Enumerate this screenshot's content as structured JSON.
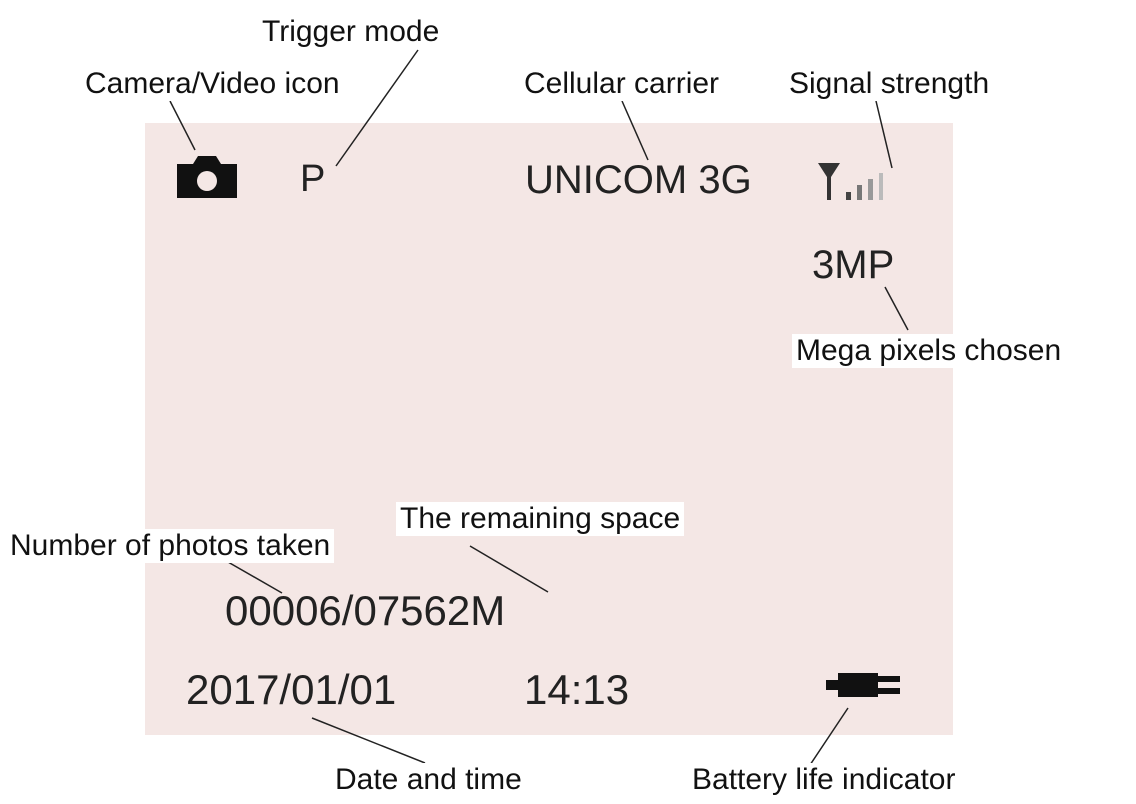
{
  "lcd": {
    "trigger_mode": "P",
    "carrier": "UNICOM 3G",
    "megapixels": "3MP",
    "photo_count_and_space": "00006/07562M",
    "date": "2017/01/01",
    "time": "14:13",
    "background_color": "#f4e7e5"
  },
  "icons": {
    "camera": "camera-icon",
    "signal": "signal-strength-icon",
    "battery": "battery-icon"
  },
  "annotations": {
    "trigger_mode": "Trigger mode",
    "camera_video_icon": "Camera/Video icon",
    "cellular_carrier": "Cellular carrier",
    "signal_strength": "Signal strength",
    "mega_pixels": "Mega pixels chosen",
    "remaining_space": "The remaining space",
    "photos_taken": "Number of photos taken",
    "date_time": "Date and time",
    "battery_life": "Battery life indicator"
  }
}
